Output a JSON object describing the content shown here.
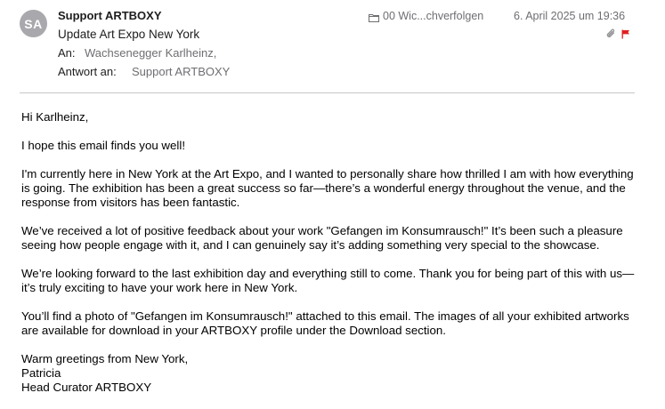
{
  "header": {
    "avatar_initials": "SA",
    "sender": "Support ARTBOXY",
    "subject": "Update Art Expo New York",
    "to_label": "An:",
    "to_value": "Wachsenegger Karlheinz,",
    "reply_label": "Antwort an:",
    "reply_value": "Support ARTBOXY",
    "folder": "00 Wic...chverfolgen",
    "date": "6. April 2025 um 19:36",
    "icons": {
      "folder": "folder-icon",
      "attachment": "paperclip-icon",
      "flag": "flag-icon"
    },
    "colors": {
      "avatar_bg": "#a8a8ad",
      "flag": "#e02020",
      "muted_text": "#6e6e73"
    }
  },
  "body": {
    "greeting": "Hi Karlheinz,",
    "p1": "I hope this email finds you well!",
    "p2": "I'm currently here in New York at the Art Expo, and I wanted to personally share how thrilled I am with how everything is going. The exhibition has been a great success so far—there’s a wonderful energy throughout the venue, and the response from visitors has been fantastic.",
    "p3": "We’ve received a lot of positive feedback about your work \"Gefangen im Konsumrausch!\" It’s been such a pleasure seeing how people engage with it, and I can genuinely say it’s adding something very special to the showcase.",
    "p4": "We’re looking forward to the last exhibition day and everything still to come. Thank you for being part of this with us—it’s truly exciting to have your work here in New York.",
    "p5": "You’ll find a photo of \"Gefangen im Konsumrausch!\" attached to this email. The images of all your exhibited artworks are available for download in your ARTBOXY profile under the Download section.",
    "closing": "Warm greetings from New York,",
    "signature_name": "Patricia",
    "signature_title": "Head Curator ARTBOXY"
  }
}
